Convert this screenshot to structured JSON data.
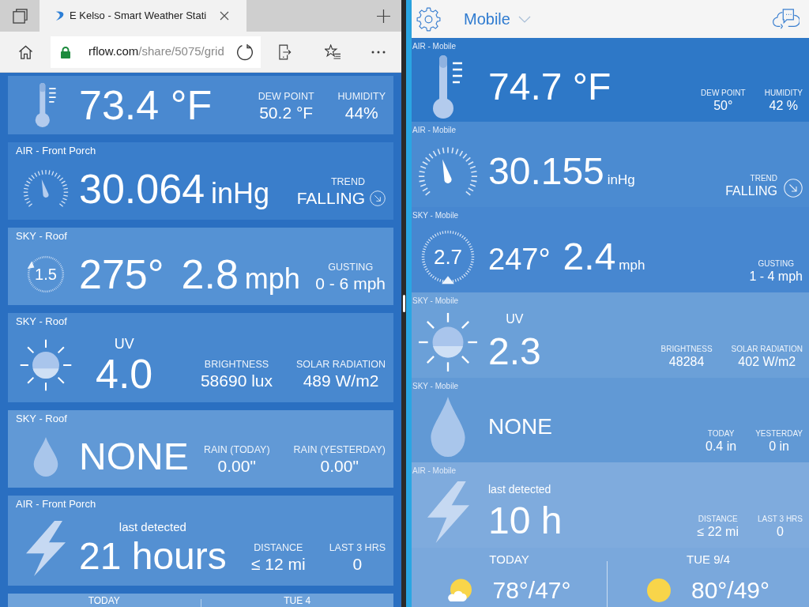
{
  "browser": {
    "tab": {
      "title": "E Kelso - Smart Weather Stati",
      "selected": true
    },
    "address": {
      "domain": "rflow.com",
      "path": "/share/5075/grid"
    }
  },
  "shared_page": {
    "cards": [
      {
        "kind": "temperature",
        "value": "73.4 °F",
        "stats": [
          {
            "label": "DEW POINT",
            "value": "50.2 °F"
          },
          {
            "label": "HUMIDITY",
            "value": "44%"
          }
        ]
      },
      {
        "kind": "pressure",
        "device": "AIR - Front Porch",
        "value": "30.064",
        "unit": "inHg",
        "stats": [
          {
            "label": "TREND",
            "value": "FALLING"
          }
        ]
      },
      {
        "kind": "wind",
        "device": "SKY - Roof",
        "dial": "1.5",
        "direction": "275°",
        "value": "2.8",
        "unit": "mph",
        "stats": [
          {
            "label": "GUSTING",
            "value": "0 - 6 mph"
          }
        ]
      },
      {
        "kind": "uv",
        "device": "SKY - Roof",
        "caption": "UV",
        "value": "4.0",
        "stats": [
          {
            "label": "BRIGHTNESS",
            "value": "58690 lux"
          },
          {
            "label": "SOLAR RADIATION",
            "value": "489 W/m2"
          }
        ]
      },
      {
        "kind": "rain",
        "device": "SKY - Roof",
        "value": "NONE",
        "stats": [
          {
            "label": "RAIN (TODAY)",
            "value": "0.00\""
          },
          {
            "label": "RAIN (YESTERDAY)",
            "value": "0.00\""
          }
        ]
      },
      {
        "kind": "lightning",
        "device": "AIR - Front Porch",
        "caption": "last detected",
        "value": "21 hours",
        "stats": [
          {
            "label": "DISTANCE",
            "value": "≤ 12 mi"
          },
          {
            "label": "LAST 3 HRS",
            "value": "0"
          }
        ]
      }
    ],
    "forecast": [
      {
        "day": "TODAY"
      },
      {
        "day": "TUE 4"
      }
    ]
  },
  "app": {
    "station": "Mobile",
    "panels": [
      {
        "kind": "temperature",
        "device": "AIR - Mobile",
        "value": "74.7 °F",
        "stats": [
          {
            "label": "DEW POINT",
            "value": "50°"
          },
          {
            "label": "HUMIDITY",
            "value": "42 %"
          }
        ]
      },
      {
        "kind": "pressure",
        "device": "AIR - Mobile",
        "value": "30.155",
        "unit": "inHg",
        "stats": [
          {
            "label": "TREND",
            "value": "FALLING"
          }
        ]
      },
      {
        "kind": "wind",
        "device": "SKY - Mobile",
        "dial": "2.7",
        "direction": "247°",
        "value": "2.4",
        "unit": "mph",
        "stats": [
          {
            "label": "GUSTING",
            "value": "1 - 4 mph"
          }
        ]
      },
      {
        "kind": "uv",
        "device": "SKY - Mobile",
        "caption": "UV",
        "value": "2.3",
        "stats": [
          {
            "label": "BRIGHTNESS",
            "value": "48284"
          },
          {
            "label": "SOLAR RADIATION",
            "value": "402 W/m2"
          }
        ]
      },
      {
        "kind": "rain",
        "device": "SKY - Mobile",
        "value": "NONE",
        "stats": [
          {
            "label": "TODAY",
            "value": "0.4 in"
          },
          {
            "label": "YESTERDAY",
            "value": "0 in"
          }
        ]
      },
      {
        "kind": "lightning",
        "device": "AIR - Mobile",
        "caption": "last detected",
        "value": "10 h",
        "stats": [
          {
            "label": "DISTANCE",
            "value": "≤ 22 mi"
          },
          {
            "label": "LAST 3 HRS",
            "value": "0"
          }
        ]
      }
    ],
    "forecast": [
      {
        "day": "TODAY",
        "kind": "partly_cloudy",
        "temperature": "78°/47°"
      },
      {
        "day": "TUE 9/4",
        "kind": "sunny",
        "temperature": "80°/49°"
      }
    ]
  }
}
